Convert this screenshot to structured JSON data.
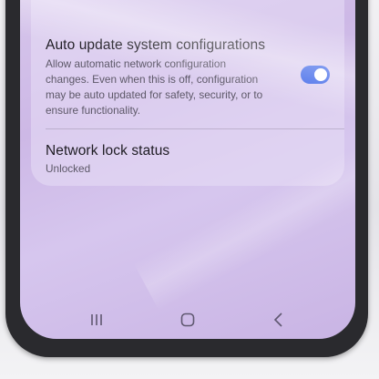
{
  "settings": {
    "auto_update": {
      "title": "Auto update system configurations",
      "description": "Allow automatic network configuration changes. Even when this is off, configuration may be auto updated for safety, security, or to ensure functionality.",
      "toggle_on": true
    },
    "network_lock": {
      "title": "Network lock status",
      "value": "Unlocked"
    }
  },
  "navbar": {
    "recents_icon": "recents-icon",
    "home_icon": "home-icon",
    "back_icon": "back-icon"
  },
  "colors": {
    "accent": "#3b64e8",
    "background": "#cdb8e6"
  }
}
